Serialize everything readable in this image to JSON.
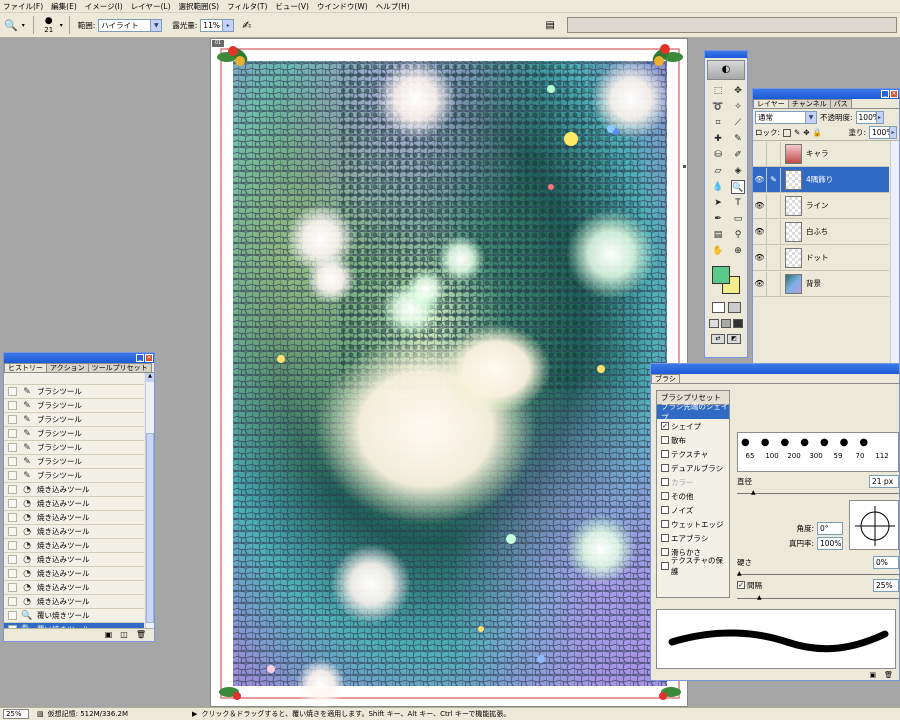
{
  "menu": [
    "ファイル(F)",
    "編集(E)",
    "イメージ(I)",
    "レイヤー(L)",
    "選択範囲(S)",
    "フィルタ(T)",
    "ビュー(V)",
    "ウインドウ(W)",
    "ヘルプ(H)"
  ],
  "options": {
    "brush_size": "21",
    "range_label": "範囲:",
    "range_value": "ハイライト",
    "exposure_label": "露光量:",
    "exposure_value": "11%"
  },
  "status": {
    "zoom": "25%",
    "memory": "仮想記憶: 512M/336.2M",
    "hint": "クリック＆ドラッグすると、覆い焼きを適用します。Shift キー、Alt キー、Ctrl キーで機能拡張。"
  },
  "history": {
    "tabs": [
      "ヒストリー",
      "アクション",
      "ツールプリセット"
    ],
    "items": [
      {
        "icon": "brush",
        "label": "ブラシツール"
      },
      {
        "icon": "brush",
        "label": "ブラシツール"
      },
      {
        "icon": "brush",
        "label": "ブラシツール"
      },
      {
        "icon": "brush",
        "label": "ブラシツール"
      },
      {
        "icon": "brush",
        "label": "ブラシツール"
      },
      {
        "icon": "brush",
        "label": "ブラシツール"
      },
      {
        "icon": "brush",
        "label": "ブラシツール"
      },
      {
        "icon": "burn",
        "label": "焼き込みツール"
      },
      {
        "icon": "burn",
        "label": "焼き込みツール"
      },
      {
        "icon": "burn",
        "label": "焼き込みツール"
      },
      {
        "icon": "burn",
        "label": "焼き込みツール"
      },
      {
        "icon": "burn",
        "label": "焼き込みツール"
      },
      {
        "icon": "burn",
        "label": "焼き込みツール"
      },
      {
        "icon": "burn",
        "label": "焼き込みツール"
      },
      {
        "icon": "burn",
        "label": "焼き込みツール"
      },
      {
        "icon": "burn",
        "label": "焼き込みツール"
      },
      {
        "icon": "dodge",
        "label": "覆い焼きツール"
      },
      {
        "icon": "dodge",
        "label": "覆い焼きツール"
      }
    ]
  },
  "layers": {
    "tabs": [
      "レイヤー",
      "チャンネル",
      "パス"
    ],
    "blend_mode": "通常",
    "opacity_label": "不透明度:",
    "opacity_value": "100%",
    "lock_label": "ロック:",
    "fill_label": "塗り:",
    "fill_value": "100%",
    "items": [
      {
        "name": "キャラ",
        "visible": false,
        "selected": false
      },
      {
        "name": "4隅飾り",
        "visible": true,
        "selected": true
      },
      {
        "name": "ライン",
        "visible": true,
        "selected": false
      },
      {
        "name": "白ふち",
        "visible": true,
        "selected": false
      },
      {
        "name": "ドット",
        "visible": true,
        "selected": false
      },
      {
        "name": "背景",
        "visible": true,
        "selected": false
      }
    ]
  },
  "brushes": {
    "title": "ブラシ",
    "options": [
      {
        "label": "ブラシプリセット",
        "type": "header"
      },
      {
        "label": "ブラシ先端のシェイプ",
        "type": "selected"
      },
      {
        "label": "シェイプ",
        "checked": true
      },
      {
        "label": "散布",
        "checked": false
      },
      {
        "label": "テクスチャ",
        "checked": false
      },
      {
        "label": "デュアルブラシ",
        "checked": false
      },
      {
        "label": "カラー",
        "checked": false,
        "disabled": true
      },
      {
        "label": "その他",
        "checked": false
      },
      {
        "label": "ノイズ",
        "checked": false
      },
      {
        "label": "ウェットエッジ",
        "checked": false
      },
      {
        "label": "エアブラシ",
        "checked": false
      },
      {
        "label": "滑らかさ",
        "checked": false
      },
      {
        "label": "テクスチャの保護",
        "checked": false
      }
    ],
    "sizes": [
      "65",
      "100",
      "200",
      "300",
      "59",
      "70",
      "112"
    ],
    "diameter_label": "直径",
    "diameter_value": "21 px",
    "angle_label": "角度:",
    "angle_value": "0°",
    "roundness_label": "真円率:",
    "roundness_value": "100%",
    "hardness_label": "硬さ",
    "hardness_value": "0%",
    "spacing_label": "間隔",
    "spacing_value": "25%"
  },
  "colors": {
    "foreground": "#5cc98a",
    "background": "#f3ec8a",
    "selection": "#316ac5"
  }
}
